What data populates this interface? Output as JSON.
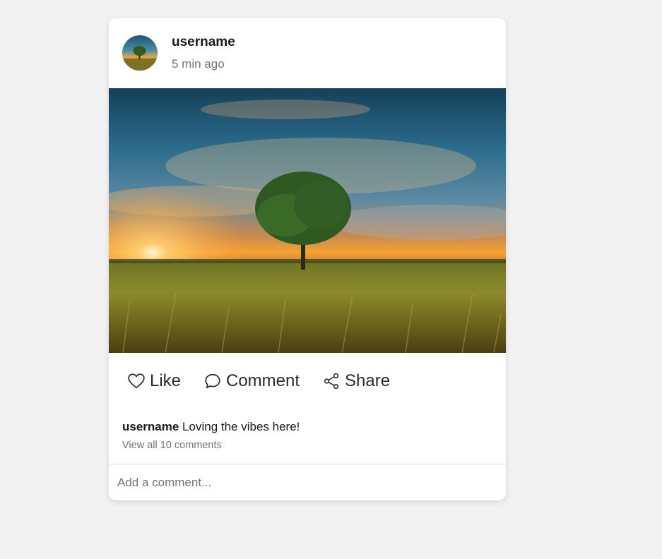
{
  "post": {
    "username": "username",
    "timestamp": "5 min ago",
    "caption_user": "username",
    "caption_text": " Loving the vibes here!",
    "view_all_comments": "View all 10 comments"
  },
  "actions": {
    "like_label": "Like",
    "comment_label": "Comment",
    "share_label": "Share"
  },
  "comment_input": {
    "placeholder": "Add a comment..."
  },
  "icons": {
    "like": "heart-icon",
    "comment": "speech-bubble-icon",
    "share": "share-nodes-icon"
  },
  "colors": {
    "background": "#f2f2f2",
    "card": "#ffffff",
    "text_primary": "#1a1a1a",
    "text_muted": "#6c757d"
  }
}
